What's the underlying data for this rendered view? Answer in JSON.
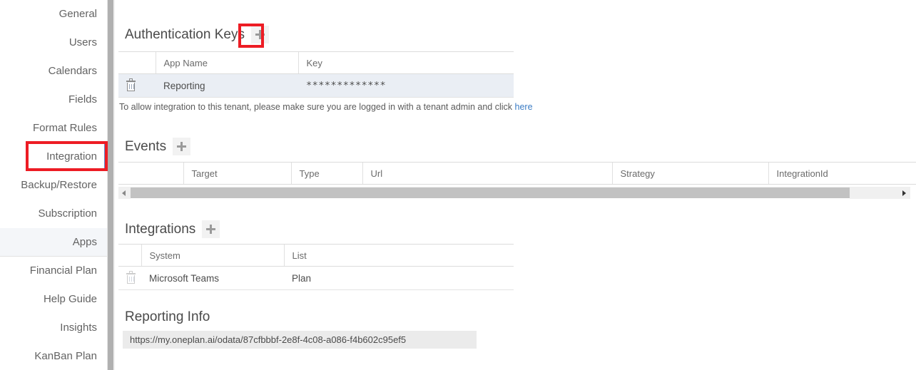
{
  "sidebar": {
    "items": [
      {
        "label": "General",
        "state": "normal"
      },
      {
        "label": "Users",
        "state": "normal"
      },
      {
        "label": "Calendars",
        "state": "normal"
      },
      {
        "label": "Fields",
        "state": "normal"
      },
      {
        "label": "Format Rules",
        "state": "normal"
      },
      {
        "label": "Integration",
        "state": "active"
      },
      {
        "label": "Backup/Restore",
        "state": "normal"
      },
      {
        "label": "Subscription",
        "state": "normal"
      },
      {
        "label": "Apps",
        "state": "selected"
      },
      {
        "label": "Financial Plan",
        "state": "normal"
      },
      {
        "label": "Help Guide",
        "state": "normal"
      },
      {
        "label": "Insights",
        "state": "normal"
      },
      {
        "label": "KanBan Plan",
        "state": "normal"
      }
    ],
    "accent_color": "#5b8fd0",
    "selected_bg": "#f4f6f9"
  },
  "annotations": {
    "highlight_color": "#ed1c24",
    "boxes": [
      "integration-nav-item",
      "auth-keys-add-button"
    ]
  },
  "auth_keys": {
    "title": "Authentication Keys",
    "add_label": "+",
    "columns": [
      "",
      "App Name",
      "Key"
    ],
    "rows": [
      {
        "delete": "delete-icon",
        "app_name": "Reporting",
        "key": "*************"
      }
    ],
    "hint_text": "To allow integration to this tenant, please make sure you are logged in with a tenant admin and click ",
    "hint_link": "here"
  },
  "events": {
    "title": "Events",
    "add_label": "+",
    "columns": [
      "",
      "Target",
      "Type",
      "Url",
      "Strategy",
      "IntegrationId"
    ],
    "rows": [],
    "scroll_left_arrow": "◀",
    "scroll_right_arrow": "▶"
  },
  "integrations": {
    "title": "Integrations",
    "add_label": "+",
    "columns": [
      "",
      "System",
      "List"
    ],
    "rows": [
      {
        "delete": "delete-icon",
        "system": "Microsoft Teams",
        "list": "Plan"
      }
    ]
  },
  "reporting_info": {
    "title": "Reporting Info",
    "url": "https://my.oneplan.ai/odata/87cfbbbf-2e8f-4c08-a086-f4b602c95ef5"
  }
}
